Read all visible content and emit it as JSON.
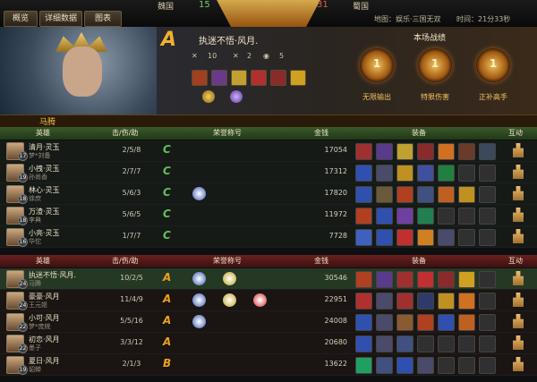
{
  "tabs": [
    "概览",
    "详细数据",
    "图表"
  ],
  "score": {
    "left_team": "魏国",
    "left_score": "15",
    "right_score": "31",
    "right_team": "蜀国"
  },
  "map_info": "地图：娱乐·三国无双",
  "time_info": "时间：21分33秒",
  "hero": {
    "grade": "A",
    "name": "执迷不悟·风月.",
    "kills": "10",
    "deaths": "2",
    "assists": "5"
  },
  "record_title": "本场战绩",
  "medals": [
    {
      "label": "无限输出",
      "rank": "1"
    },
    {
      "label": "特狠伤害",
      "rank": "1"
    },
    {
      "label": "正补高手",
      "rank": "1"
    }
  ],
  "player_label": "马腾",
  "headers": [
    "英雄",
    "击/伤/助",
    "荣誉称号",
    "金钱",
    "装备",
    "互动"
  ],
  "team1": [
    {
      "player": "清月·灵玉",
      "hero": "梦*刘备",
      "level": "17",
      "kda": "2/5/8",
      "grade": "C",
      "gold": "17054",
      "honors": 0
    },
    {
      "player": "小拽·灵玉",
      "hero": "孙尚香",
      "level": "19",
      "kda": "2/7/7",
      "grade": "C",
      "gold": "17312",
      "honors": 0
    },
    {
      "player": "林心·灵玉",
      "hero": "徐庶",
      "level": "18",
      "kda": "5/6/3",
      "grade": "C",
      "gold": "17820",
      "honors": 1
    },
    {
      "player": "万渣·灵玉",
      "hero": "李典",
      "level": "18",
      "kda": "5/6/5",
      "grade": "C",
      "gold": "11972",
      "honors": 0
    },
    {
      "player": "小亮·灵玉",
      "hero": "华佗",
      "level": "16",
      "kda": "1/7/7",
      "grade": "C",
      "gold": "7728",
      "honors": 0
    }
  ],
  "team2": [
    {
      "player": "执迷不悟·风月.",
      "hero": "马腾",
      "level": "24",
      "kda": "10/2/5",
      "grade": "A",
      "gold": "30546",
      "honors": 2
    },
    {
      "player": "豪豪·风月",
      "hero": "王元姬",
      "level": "24",
      "kda": "11/4/9",
      "grade": "A",
      "gold": "22951",
      "honors": 3
    },
    {
      "player": "小可·风月",
      "hero": "梦*庞统",
      "level": "22",
      "kda": "5/5/16",
      "grade": "A",
      "gold": "24008",
      "honors": 1
    },
    {
      "player": "初恋·风月",
      "hero": "墨子",
      "level": "22",
      "kda": "3/3/12",
      "grade": "A",
      "gold": "20680",
      "honors": 0
    },
    {
      "player": "夏日·风月",
      "hero": "貂蝉",
      "level": "19",
      "kda": "2/1/3",
      "grade": "B",
      "gold": "13622",
      "honors": 0
    }
  ]
}
